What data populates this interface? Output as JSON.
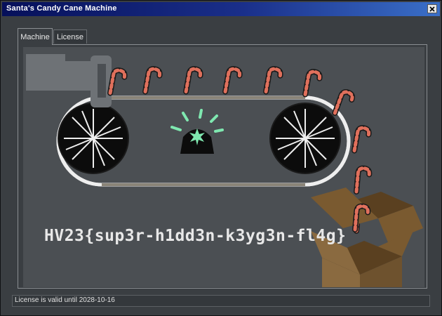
{
  "window": {
    "title": "Santa's Candy Cane Machine",
    "close_icon": "close-icon"
  },
  "tabs": [
    {
      "label": "Machine",
      "active": true
    },
    {
      "label": "License",
      "active": false
    }
  ],
  "machine": {
    "flag_text": "HV23{sup3r-h1dd3n-k3yg3n-fl4g}",
    "icons": [
      "hopper-icon",
      "conveyor-belt-icon",
      "gear-wheel-icon",
      "siren-light-icon",
      "candy-cane-icon",
      "cardboard-box-icon"
    ],
    "colors": {
      "background": "#4b4f53",
      "siren_glow": "#7fe8b0",
      "candy_stripe": "#e0705c",
      "box": "#8a6a40"
    }
  },
  "status": {
    "text": "License is valid until 2028-10-16"
  }
}
